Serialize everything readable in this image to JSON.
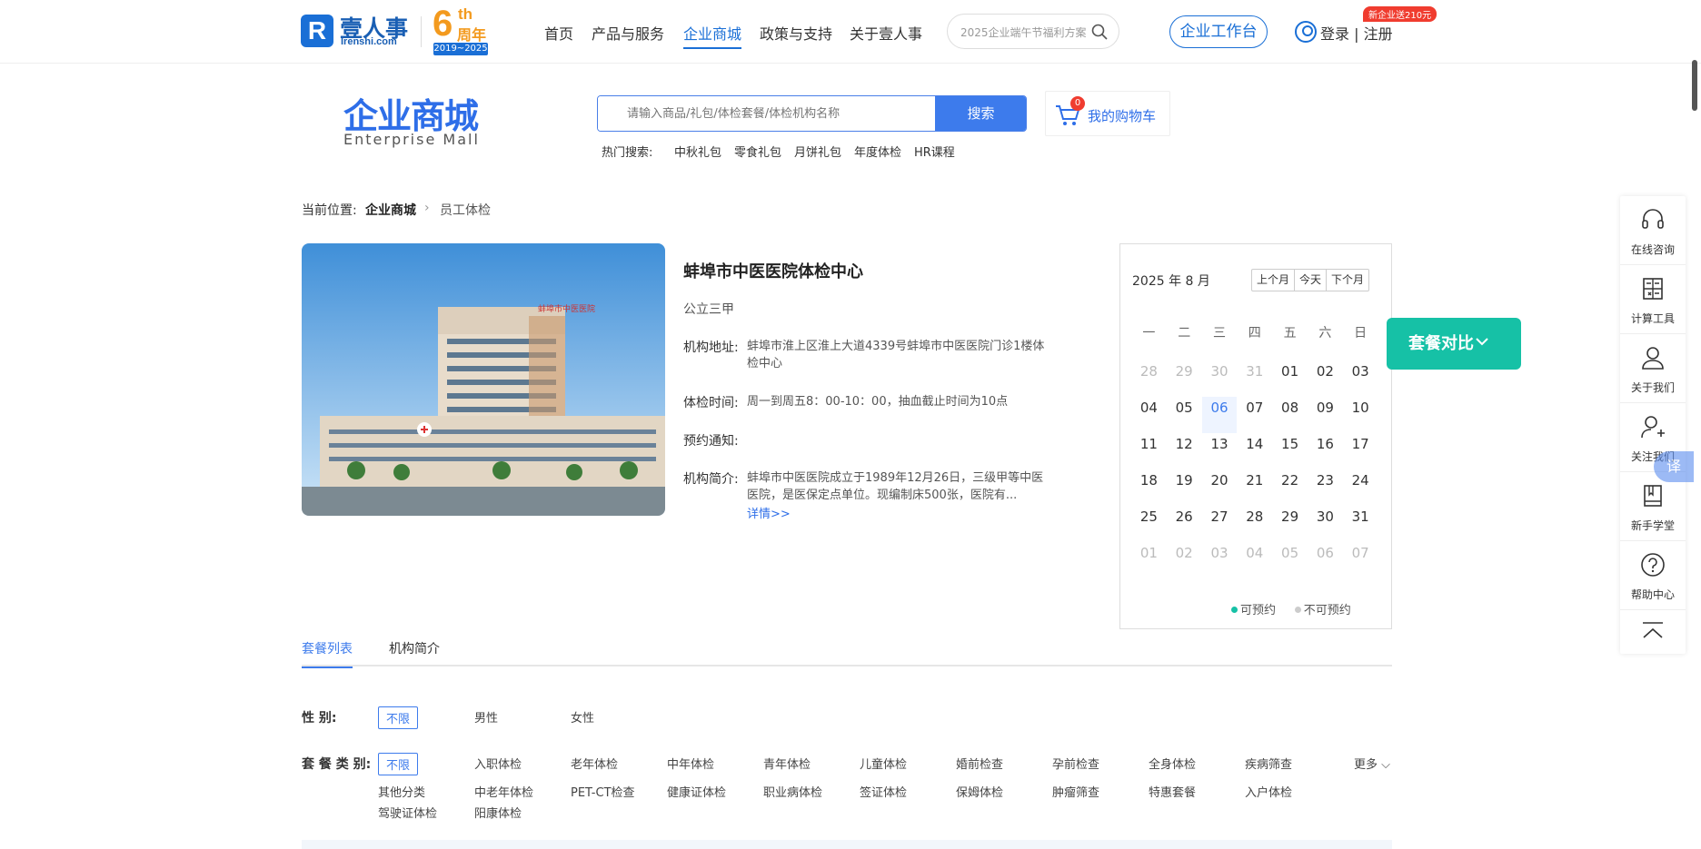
{
  "header": {
    "logo_cn": "壹人事",
    "logo_en": "Irenshi.com",
    "anniversary_num": "6",
    "anniversary_th": "th",
    "anniversary_cn": "周年",
    "anniversary_years": "2019~2025",
    "nav": [
      "首页",
      "产品与服务",
      "企业商城",
      "政策与支持",
      "关于壹人事"
    ],
    "search_placeholder": "2025企业端午节福利方案",
    "workbench_button": "企业工作台",
    "login_text": "登录 | 注册",
    "promo_badge": "新企业送210元"
  },
  "mall": {
    "title": "企业商城",
    "subtitle": "Enterprise  Mall",
    "search_placeholder": "请输入商品/礼包/体检套餐/体检机构名称",
    "search_button": "搜索",
    "hot_label": "热门搜索:",
    "hot_terms": [
      "中秋礼包",
      "零食礼包",
      "月饼礼包",
      "年度体检",
      "HR课程"
    ],
    "cart_count": "0",
    "cart_label": "我的购物车"
  },
  "breadcrumb": {
    "prefix": "当前位置:",
    "items": [
      "企业商城",
      "员工体检"
    ]
  },
  "institution": {
    "name": "蚌埠市中医医院体检中心",
    "level": "公立三甲",
    "address_label": "机构地址:",
    "address": "蚌埠市淮上区淮上大道4339号蚌埠市中医医院门诊1楼体检中心",
    "hours_label": "体检时间:",
    "hours": "周一到周五8：00-10：00，抽血截止时间为10点",
    "notice_label": "预约通知:",
    "notice": "",
    "intro_label": "机构简介:",
    "intro": "蚌埠市中医医院成立于1989年12月26日，三级甲等中医医院，是医保定点单位。现编制床500张，医院有...",
    "more_link": "详情>>",
    "building_sign": "蚌埠市中医医院"
  },
  "calendar": {
    "month_title": "2025 年 8 月",
    "buttons": [
      "上个月",
      "今天",
      "下个月"
    ],
    "weekdays": [
      "一",
      "二",
      "三",
      "四",
      "五",
      "六",
      "日"
    ],
    "weeks": [
      [
        "28",
        "29",
        "30",
        "31",
        "01",
        "02",
        "03"
      ],
      [
        "04",
        "05",
        "06",
        "07",
        "08",
        "09",
        "10"
      ],
      [
        "11",
        "12",
        "13",
        "14",
        "15",
        "16",
        "17"
      ],
      [
        "18",
        "19",
        "20",
        "21",
        "22",
        "23",
        "24"
      ],
      [
        "25",
        "26",
        "27",
        "28",
        "29",
        "30",
        "31"
      ],
      [
        "01",
        "02",
        "03",
        "04",
        "05",
        "06",
        "07"
      ]
    ],
    "today": "06",
    "legend_available": "可预约",
    "legend_unavailable": "不可预约",
    "available_color": "#16c1a6",
    "unavailable_color": "#cccccc"
  },
  "compare_button": "套餐对比",
  "sidebar": [
    {
      "label": "在线咨询",
      "icon": "headset-icon"
    },
    {
      "label": "计算工具",
      "icon": "calculator-icon"
    },
    {
      "label": "关于我们",
      "icon": "user-icon"
    },
    {
      "label": "关注我们",
      "icon": "user-add-icon"
    },
    {
      "label": "新手学堂",
      "icon": "book-icon"
    },
    {
      "label": "帮助中心",
      "icon": "help-icon"
    }
  ],
  "translate_label": "译",
  "tabs": [
    "套餐列表",
    "机构简介"
  ],
  "filters": {
    "gender_label": "性        别:",
    "gender_options": [
      "不限",
      "男性",
      "女性"
    ],
    "category_label": "套 餐 类 别:",
    "category_options_row1": [
      "不限",
      "入职体检",
      "老年体检",
      "中年体检",
      "青年体检",
      "儿童体检",
      "婚前检查",
      "孕前检查",
      "全身体检",
      "疾病筛查"
    ],
    "category_options_row2": [
      "其他分类",
      "中老年体检",
      "PET-CT检查",
      "健康证体检",
      "职业病体检",
      "签证体检",
      "保姆体检",
      "肿瘤筛查",
      "特惠套餐",
      "入户体检"
    ],
    "category_options_row3": [
      "驾驶证体检",
      "阳康体检"
    ],
    "more_label": "更多"
  },
  "colors": {
    "brand_blue": "#1a6fd6",
    "accent_blue": "#3d7bec",
    "teal": "#16c1a6",
    "anniversary_orange": "#f39a1e",
    "promo_red": "#f03c2f"
  }
}
